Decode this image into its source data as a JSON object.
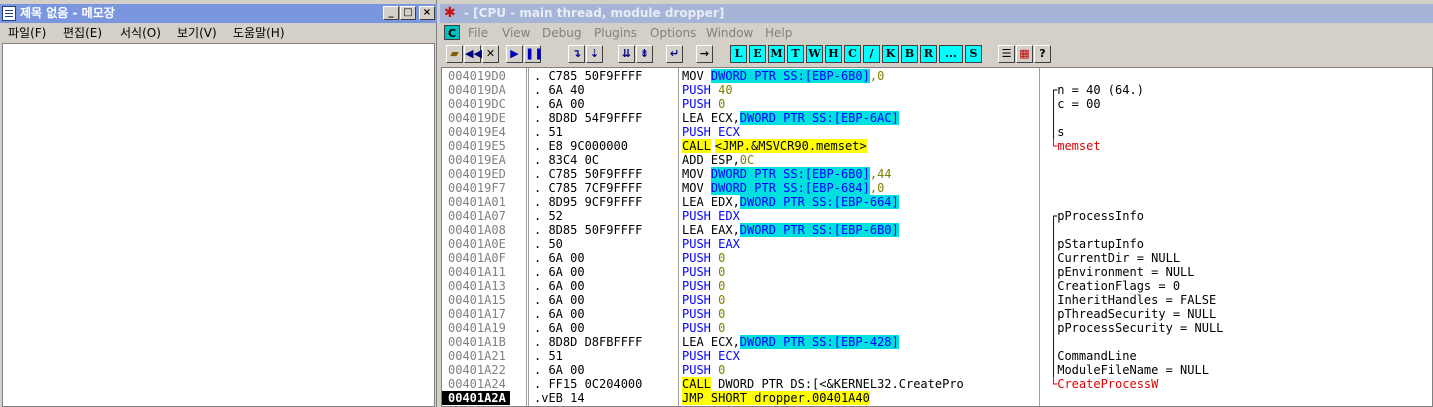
{
  "notepad": {
    "title": "제목 없음 - 메모장",
    "menu": [
      "파일(F)",
      "편집(E)",
      "서식(O)",
      "보기(V)",
      "도움말(H)"
    ],
    "window_buttons": [
      "_",
      "□",
      "×"
    ]
  },
  "olly": {
    "title": "- [CPU - main thread, module dropper]",
    "menu": [
      "File",
      "View",
      "Debug",
      "Plugins",
      "Options",
      "Window",
      "Help"
    ],
    "toolbar_letters": [
      "L",
      "E",
      "M",
      "T",
      "W",
      "H",
      "C",
      "/",
      "K",
      "B",
      "R",
      "...",
      "S"
    ],
    "rows": [
      {
        "addr": "004019D0",
        "hex": ". C785 50F9FFFF",
        "op": "MOV ",
        "arg": "DWORD PTR SS:[EBP-6B0]",
        "rest": ",0",
        "cmt": ""
      },
      {
        "addr": "004019DA",
        "hex": ". 6A 40",
        "op": "PUSH ",
        "arg": "",
        "rest": "40",
        "cmt": "┌n = 40 (64.)"
      },
      {
        "addr": "004019DC",
        "hex": ". 6A 00",
        "op": "PUSH ",
        "arg": "",
        "rest": "0",
        "cmt": "│c = 00"
      },
      {
        "addr": "004019DE",
        "hex": ". 8D8D 54F9FFFF",
        "op": "LEA ECX,",
        "arg": "DWORD PTR SS:[EBP-6AC]",
        "rest": "",
        "cmt": "│"
      },
      {
        "addr": "004019E4",
        "hex": ". 51",
        "op": "PUSH ECX",
        "arg": "",
        "rest": "",
        "cmt": "│s"
      },
      {
        "addr": "004019E5",
        "hex": ". E8 9C000000",
        "op": "CALL",
        "arg": "<JMP.&MSVCR90.memset>",
        "rest": "",
        "cmt": "└memset"
      },
      {
        "addr": "004019EA",
        "hex": ". 83C4 0C",
        "op": "ADD ESP,",
        "arg": "",
        "rest": "0C",
        "cmt": ""
      },
      {
        "addr": "004019ED",
        "hex": ". C785 50F9FFFF",
        "op": "MOV ",
        "arg": "DWORD PTR SS:[EBP-6B0]",
        "rest": ",44",
        "cmt": ""
      },
      {
        "addr": "004019F7",
        "hex": ". C785 7CF9FFFF",
        "op": "MOV ",
        "arg": "DWORD PTR SS:[EBP-684]",
        "rest": ",0",
        "cmt": ""
      },
      {
        "addr": "00401A01",
        "hex": ". 8D95 9CF9FFFF",
        "op": "LEA EDX,",
        "arg": "DWORD PTR SS:[EBP-664]",
        "rest": "",
        "cmt": ""
      },
      {
        "addr": "00401A07",
        "hex": ". 52",
        "op": "PUSH EDX",
        "arg": "",
        "rest": "",
        "cmt": "┌pProcessInfo"
      },
      {
        "addr": "00401A08",
        "hex": ". 8D85 50F9FFFF",
        "op": "LEA EAX,",
        "arg": "DWORD PTR SS:[EBP-6B0]",
        "rest": "",
        "cmt": "│"
      },
      {
        "addr": "00401A0E",
        "hex": ". 50",
        "op": "PUSH EAX",
        "arg": "",
        "rest": "",
        "cmt": "│pStartupInfo"
      },
      {
        "addr": "00401A0F",
        "hex": ". 6A 00",
        "op": "PUSH ",
        "arg": "",
        "rest": "0",
        "cmt": "│CurrentDir = NULL"
      },
      {
        "addr": "00401A11",
        "hex": ". 6A 00",
        "op": "PUSH ",
        "arg": "",
        "rest": "0",
        "cmt": "│pEnvironment = NULL"
      },
      {
        "addr": "00401A13",
        "hex": ". 6A 00",
        "op": "PUSH ",
        "arg": "",
        "rest": "0",
        "cmt": "│CreationFlags = 0"
      },
      {
        "addr": "00401A15",
        "hex": ". 6A 00",
        "op": "PUSH ",
        "arg": "",
        "rest": "0",
        "cmt": "│InheritHandles = FALSE"
      },
      {
        "addr": "00401A17",
        "hex": ". 6A 00",
        "op": "PUSH ",
        "arg": "",
        "rest": "0",
        "cmt": "│pThreadSecurity = NULL"
      },
      {
        "addr": "00401A19",
        "hex": ". 6A 00",
        "op": "PUSH ",
        "arg": "",
        "rest": "0",
        "cmt": "│pProcessSecurity = NULL"
      },
      {
        "addr": "00401A1B",
        "hex": ". 8D8D D8FBFFFF",
        "op": "LEA ECX,",
        "arg": "DWORD PTR SS:[EBP-428]",
        "rest": "",
        "cmt": "│"
      },
      {
        "addr": "00401A21",
        "hex": ". 51",
        "op": "PUSH ECX",
        "arg": "",
        "rest": "",
        "cmt": "│CommandLine"
      },
      {
        "addr": "00401A22",
        "hex": ". 6A 00",
        "op": "PUSH ",
        "arg": "",
        "rest": "0",
        "cmt": "│ModuleFileName = NULL"
      },
      {
        "addr": "00401A24",
        "hex": ". FF15 0C204000",
        "op": "CALL",
        "arg": "",
        "rest": " DWORD PTR DS:[<&KERNEL32.CreatePro",
        "cmt": "└CreateProcessW"
      },
      {
        "addr": "00401A2A",
        "hex": ".vEB 14",
        "op": "JMP",
        "arg": "",
        "rest": " SHORT dropper.00401A40",
        "cmt": ""
      }
    ]
  }
}
